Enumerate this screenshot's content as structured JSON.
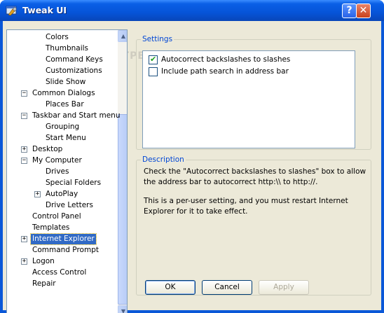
{
  "window": {
    "title": "Tweak UI",
    "help_glyph": "?",
    "close_glyph": "✕",
    "titlebar_color": "#0654d8"
  },
  "tree": {
    "items": [
      {
        "label": "Colors",
        "level": 2,
        "expander": "",
        "selected": false
      },
      {
        "label": "Thumbnails",
        "level": 2,
        "expander": "",
        "selected": false
      },
      {
        "label": "Command Keys",
        "level": 2,
        "expander": "",
        "selected": false
      },
      {
        "label": "Customizations",
        "level": 2,
        "expander": "",
        "selected": false
      },
      {
        "label": "Slide Show",
        "level": 2,
        "expander": "",
        "selected": false
      },
      {
        "label": "Common Dialogs",
        "level": 1,
        "expander": "−",
        "selected": false
      },
      {
        "label": "Places Bar",
        "level": 2,
        "expander": "",
        "selected": false
      },
      {
        "label": "Taskbar and Start menu",
        "level": 1,
        "expander": "−",
        "selected": false
      },
      {
        "label": "Grouping",
        "level": 2,
        "expander": "",
        "selected": false
      },
      {
        "label": "Start Menu",
        "level": 2,
        "expander": "",
        "selected": false
      },
      {
        "label": "Desktop",
        "level": 1,
        "expander": "+",
        "selected": false
      },
      {
        "label": "My Computer",
        "level": 1,
        "expander": "−",
        "selected": false
      },
      {
        "label": "Drives",
        "level": 2,
        "expander": "",
        "selected": false
      },
      {
        "label": "Special Folders",
        "level": 2,
        "expander": "",
        "selected": false
      },
      {
        "label": "AutoPlay",
        "level": 2,
        "expander": "+",
        "selected": false
      },
      {
        "label": "Drive Letters",
        "level": 2,
        "expander": "",
        "selected": false
      },
      {
        "label": "Control Panel",
        "level": 1,
        "expander": "",
        "selected": false
      },
      {
        "label": "Templates",
        "level": 1,
        "expander": "",
        "selected": false
      },
      {
        "label": "Internet Explorer",
        "level": 1,
        "expander": "+",
        "selected": true
      },
      {
        "label": "Command Prompt",
        "level": 1,
        "expander": "",
        "selected": false
      },
      {
        "label": "Logon",
        "level": 1,
        "expander": "+",
        "selected": false
      },
      {
        "label": "Access Control",
        "level": 1,
        "expander": "",
        "selected": false
      },
      {
        "label": "Repair",
        "level": 1,
        "expander": "",
        "selected": false
      }
    ],
    "scroll_up_glyph": "▲",
    "scroll_down_glyph": "▼",
    "selection_color": "#316ac5"
  },
  "settings": {
    "group_title": "Settings",
    "options": [
      {
        "label": "Autocorrect backslashes to slashes",
        "checked": true
      },
      {
        "label": "Include path search in address bar",
        "checked": false
      }
    ]
  },
  "description": {
    "group_title": "Description",
    "paragraph1": "Check the \"Autocorrect backslashes to slashes\" box to allow the address bar to autocorrect http:\\\\ to http://.",
    "paragraph2": "This is a per-user setting, and you must restart Internet Explorer for it to take effect."
  },
  "buttons": {
    "ok": "OK",
    "cancel": "Cancel",
    "apply": "Apply"
  },
  "watermark": "SOFTPEDIA"
}
